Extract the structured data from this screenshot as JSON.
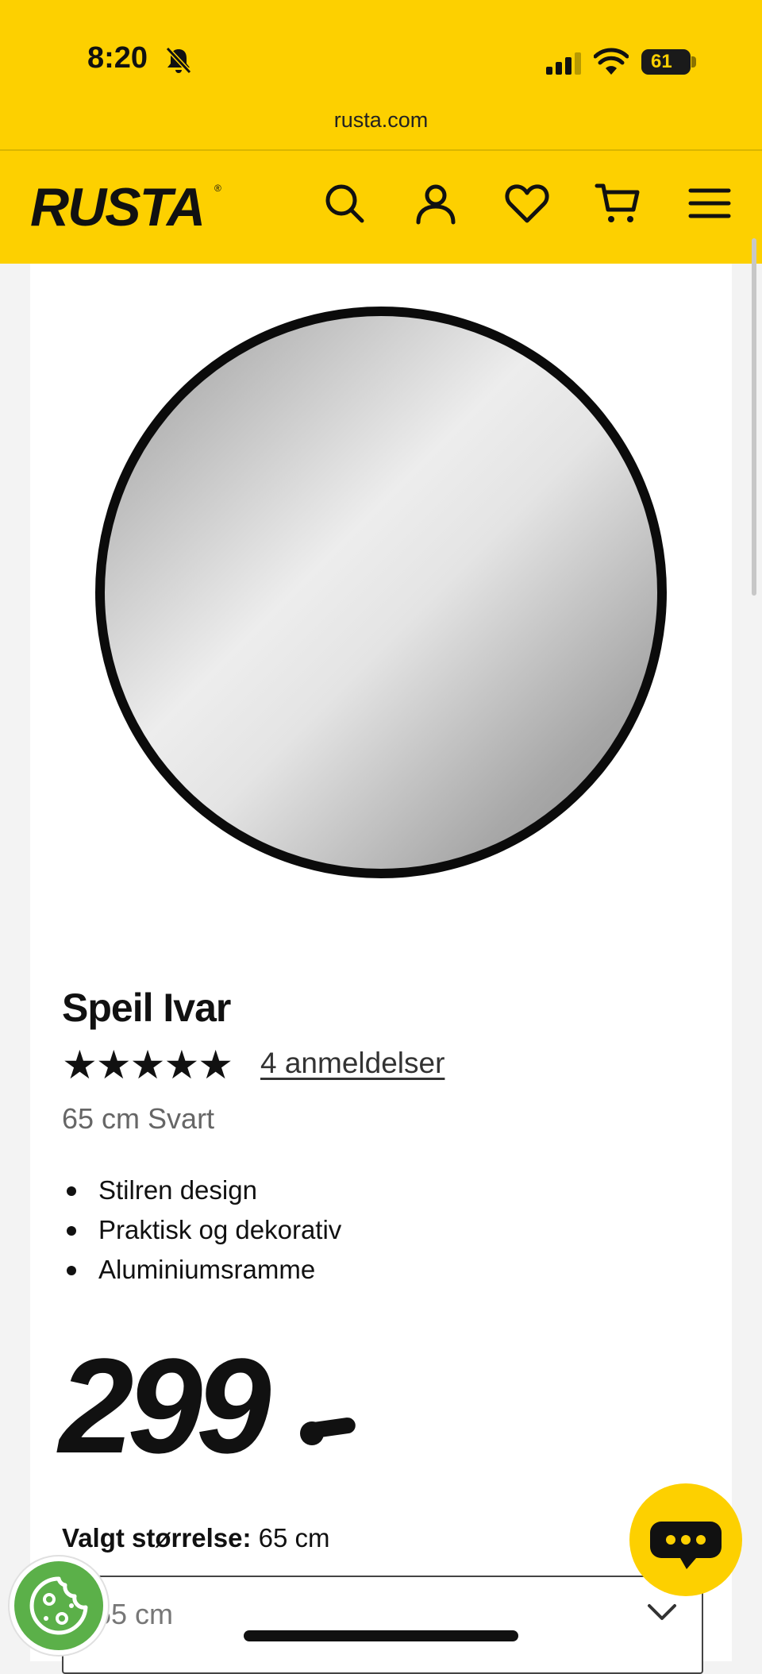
{
  "status_bar": {
    "time": "8:20",
    "battery": "61"
  },
  "browser": {
    "url": "rusta.com"
  },
  "header": {
    "logo": "RUSTA",
    "icons": [
      "search-icon",
      "account-icon",
      "heart-icon",
      "cart-icon",
      "menu-icon"
    ]
  },
  "product": {
    "title": "Speil Ivar",
    "rating_stars": "★★★★★",
    "rating": 5,
    "reviews_link": "4 anmeldelser",
    "variant": "65 cm Svart",
    "features": [
      "Stilren design",
      "Praktisk og dekorativ",
      "Aluminiumsramme"
    ],
    "price": "299"
  },
  "size_selector": {
    "label": "Valgt størrelse:",
    "label_value": "65 cm",
    "selected": "65 cm"
  },
  "colors": {
    "brand_yellow": "#fdd000",
    "cookie_green": "#5bb049"
  }
}
